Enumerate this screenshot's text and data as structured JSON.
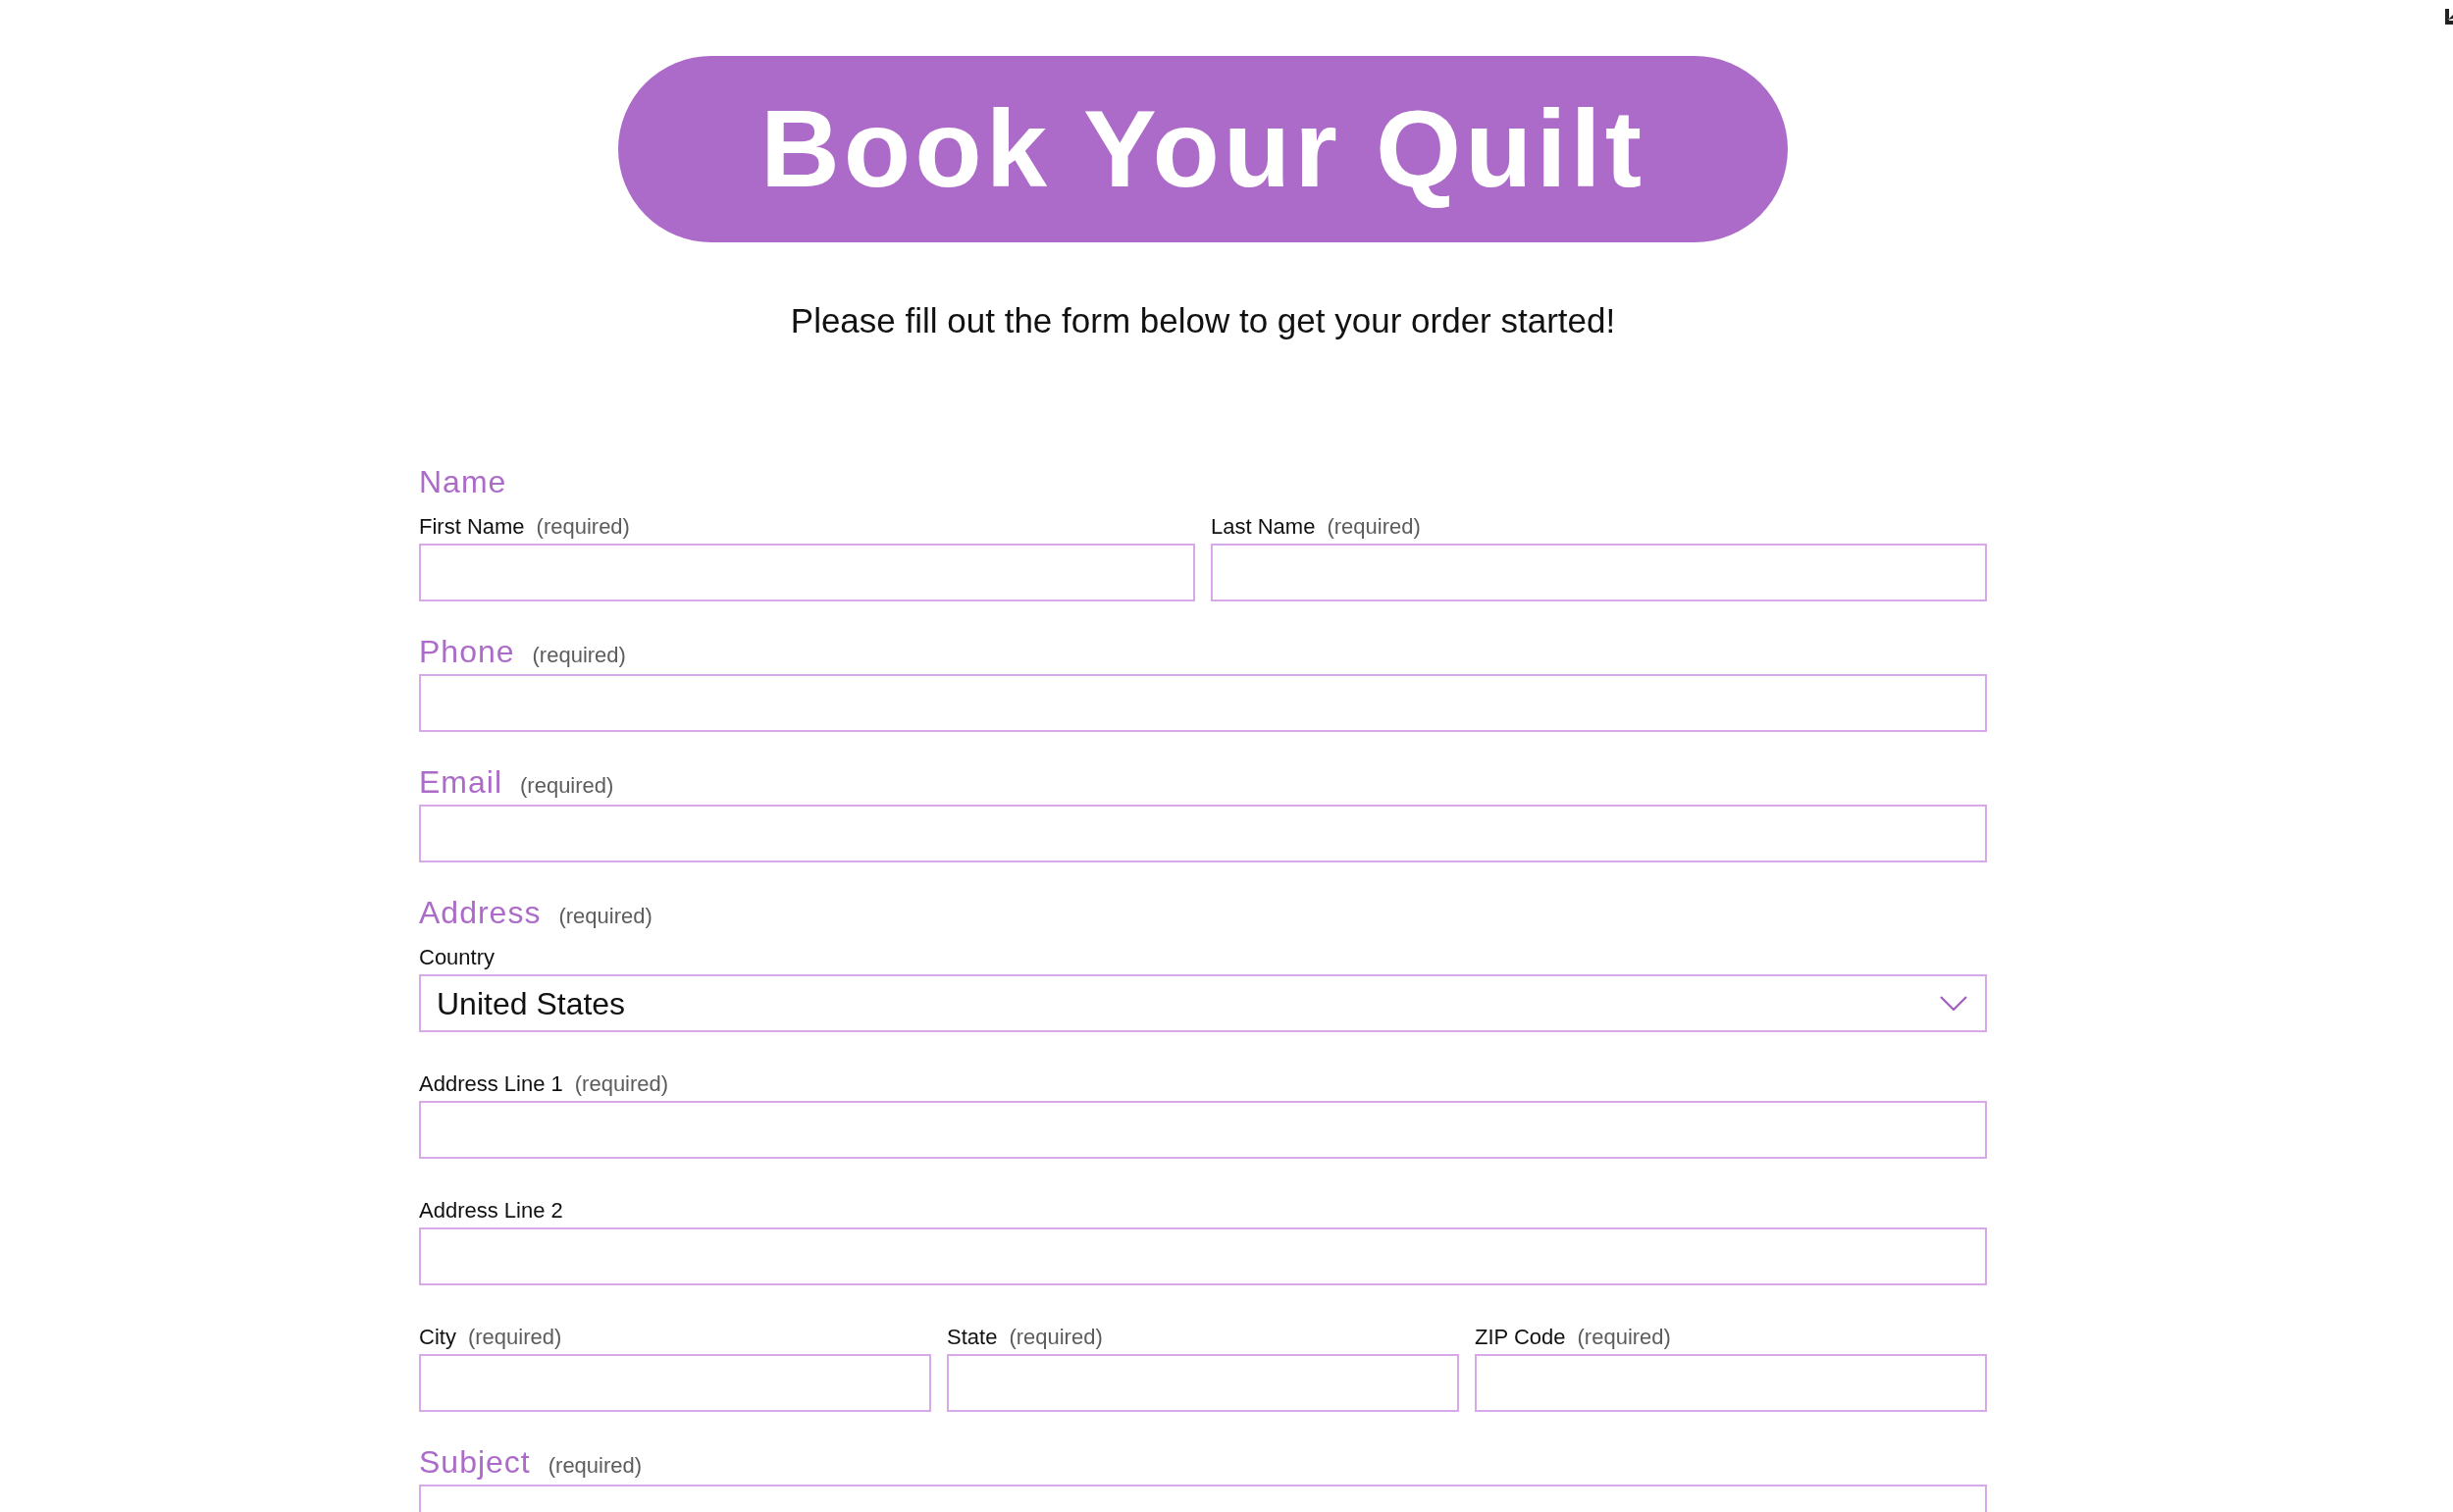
{
  "header": {
    "title": "Book Your Quilt",
    "subtitle": "Please fill out the form below to get your order started!"
  },
  "form": {
    "sections": [
      {
        "heading": "Name",
        "rows": [
          {
            "fields": [
              {
                "kind": "text",
                "label": "First Name",
                "note": "(required)"
              },
              {
                "kind": "text",
                "label": "Last Name",
                "note": "(required)"
              }
            ]
          }
        ]
      },
      {
        "heading": "Phone",
        "note": "(required)",
        "rows": [
          {
            "fields": [
              {
                "kind": "text"
              }
            ]
          }
        ]
      },
      {
        "heading": "Email",
        "note": "(required)",
        "rows": [
          {
            "fields": [
              {
                "kind": "text"
              }
            ]
          }
        ]
      },
      {
        "heading": "Address",
        "note": "(required)",
        "rows": [
          {
            "fields": [
              {
                "kind": "select",
                "label": "Country",
                "value": "United States"
              }
            ]
          },
          {
            "fields": [
              {
                "kind": "text",
                "label": "Address Line 1",
                "note": "(required)"
              }
            ]
          },
          {
            "fields": [
              {
                "kind": "text",
                "label": "Address Line 2"
              }
            ]
          },
          {
            "fields": [
              {
                "kind": "text",
                "label": "City",
                "note": "(required)"
              },
              {
                "kind": "text",
                "label": "State",
                "note": "(required)"
              },
              {
                "kind": "text",
                "label": "ZIP Code",
                "note": "(required)"
              }
            ]
          }
        ]
      },
      {
        "heading": "Subject",
        "note": "(required)",
        "rows": [
          {
            "fields": [
              {
                "kind": "text"
              }
            ]
          }
        ]
      }
    ]
  }
}
